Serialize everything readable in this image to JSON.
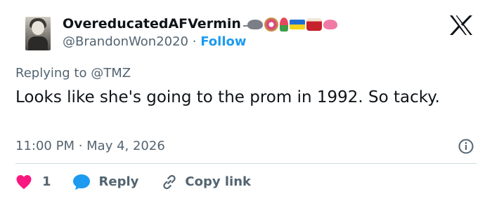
{
  "author": {
    "display_name": "OvereducatedAFVermin",
    "handle": "@BrandonWon2020",
    "separator": "·",
    "follow_label": "Follow",
    "name_emojis": [
      "rat",
      "donut",
      "flower",
      "ukraine-flag",
      "drum",
      "lotus"
    ]
  },
  "reply_context": {
    "prefix": "Replying to",
    "mention": "@TMZ"
  },
  "tweet": {
    "text": "Looks like she's going to the prom in 1992. So tacky.",
    "timestamp": "11:00 PM · May 4, 2026"
  },
  "actions": {
    "like_count": "1",
    "reply_label": "Reply",
    "copy_link_label": "Copy link"
  },
  "colors": {
    "like": "#f91880",
    "reply": "#1d9bf0",
    "link_blue": "#1d9bf0",
    "muted": "#536471",
    "text": "#0f1419"
  },
  "icons": {
    "brand": "x-logo-icon",
    "info": "info-icon",
    "like": "heart-icon",
    "reply": "speech-bubble-icon",
    "copy": "link-icon"
  }
}
